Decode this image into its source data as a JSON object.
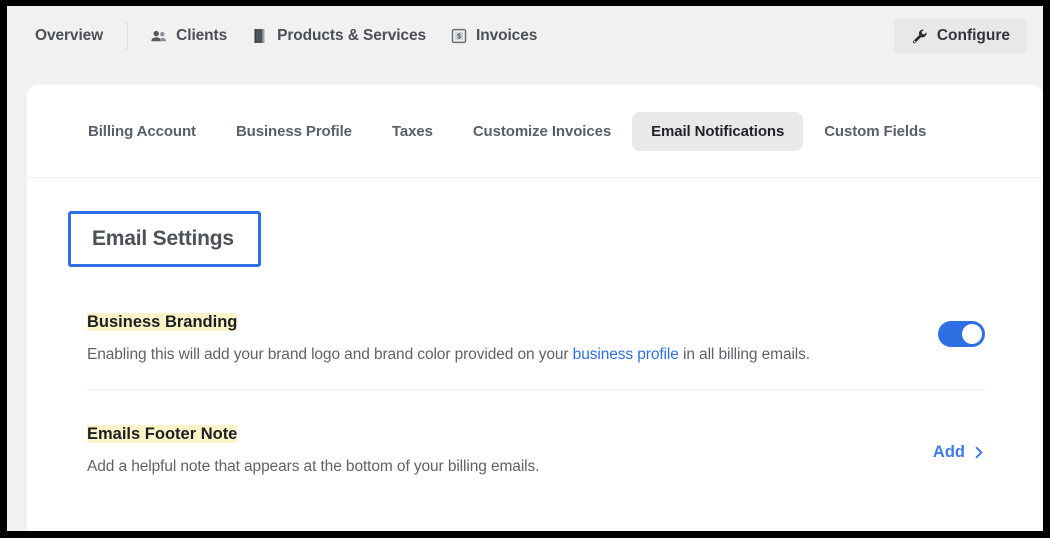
{
  "topnav": {
    "items": [
      {
        "label": "Overview",
        "icon": "none"
      },
      {
        "label": "Clients",
        "icon": "people-icon"
      },
      {
        "label": "Products & Services",
        "icon": "book-icon"
      },
      {
        "label": "Invoices",
        "icon": "invoice-icon"
      }
    ],
    "configure_label": "Configure",
    "configure_icon": "wrench-icon"
  },
  "tabs": [
    {
      "label": "Billing Account",
      "active": false
    },
    {
      "label": "Business Profile",
      "active": false
    },
    {
      "label": "Taxes",
      "active": false
    },
    {
      "label": "Customize Invoices",
      "active": false
    },
    {
      "label": "Email Notifications",
      "active": true
    },
    {
      "label": "Custom Fields",
      "active": false
    }
  ],
  "page": {
    "section_title": "Email Settings"
  },
  "settings": [
    {
      "label": "Business Branding",
      "desc_before": "Enabling this will add your brand logo and brand color provided on your ",
      "desc_link": "business profile",
      "desc_after": " in all billing emails.",
      "control": "toggle",
      "toggle_on": true
    },
    {
      "label": "Emails Footer Note",
      "desc": "Add a helpful note that appears at the bottom of your billing emails.",
      "control": "link",
      "action_label": "Add",
      "action_icon": "chevron-right-icon"
    }
  ],
  "colors": {
    "accent_blue": "#2f6fe4",
    "link_blue": "#3f7bec",
    "highlight_yellow": "#fbf4c8",
    "page_bg": "#f1f1f1",
    "card_bg": "#ffffff",
    "active_tab_bg": "#e9e9ea"
  }
}
